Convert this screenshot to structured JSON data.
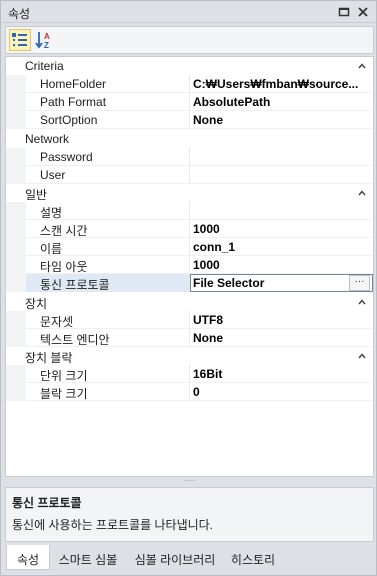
{
  "window": {
    "title": "속성"
  },
  "toolbar": {
    "categorized_icon": "categorized-list-icon",
    "alphabetical_icon": "sort-alpha-icon"
  },
  "categories": [
    {
      "label": "Criteria",
      "properties": [
        {
          "name": "HomeFolder",
          "value": "C:₩Users₩fmban₩source..."
        },
        {
          "name": "Path Format",
          "value": "AbsolutePath"
        },
        {
          "name": "SortOption",
          "value": "None"
        }
      ]
    },
    {
      "label": "Network",
      "properties": [
        {
          "name": "Password",
          "value": ""
        },
        {
          "name": "User",
          "value": ""
        }
      ]
    },
    {
      "label": "일반",
      "properties": [
        {
          "name": "설명",
          "value": ""
        },
        {
          "name": "스캔 시간",
          "value": "1000"
        },
        {
          "name": "이름",
          "value": "conn_1"
        },
        {
          "name": "타임 아웃",
          "value": "1000"
        },
        {
          "name": "통신 프로토콜",
          "value": "File Selector"
        }
      ]
    },
    {
      "label": "장치",
      "properties": [
        {
          "name": "문자셋",
          "value": "UTF8"
        },
        {
          "name": "텍스트 엔디안",
          "value": "None"
        }
      ]
    },
    {
      "label": "장치 블락",
      "properties": [
        {
          "name": "단위 크기",
          "value": "16Bit"
        },
        {
          "name": "블락 크기",
          "value": "0"
        }
      ]
    }
  ],
  "editor": {
    "ellipsis_label": "···"
  },
  "description": {
    "title": "통신 프로토콜",
    "body": "통신에 사용하는 프로트콜를 나타냅니다."
  },
  "tabs": [
    {
      "label": "속성",
      "active": true
    },
    {
      "label": "스마트 심볼",
      "active": false
    },
    {
      "label": "심볼 라이브러리",
      "active": false
    },
    {
      "label": "히스토리",
      "active": false
    }
  ],
  "splitter_glyph": "····"
}
